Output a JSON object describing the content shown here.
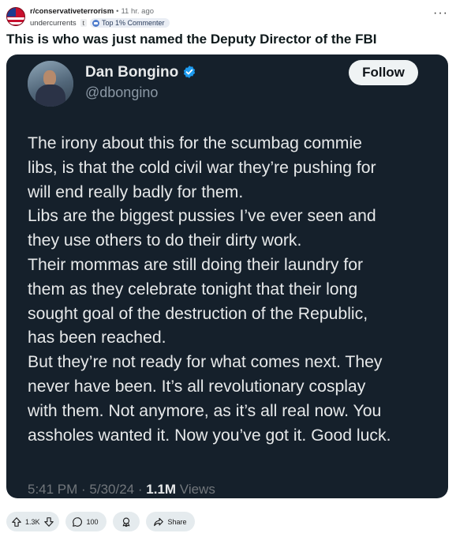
{
  "post": {
    "subreddit": "r/conservativeterrorism",
    "separator": "•",
    "time_ago": "11 hr. ago",
    "author": "undercurrents",
    "author_flair": "t",
    "commenter_badge": "Top 1% Commenter",
    "title": "This is who was just named the Deputy Director of the FBI",
    "more_icon": "more-horizontal-icon"
  },
  "tweet": {
    "display_name": "Dan Bongino",
    "handle": "@dbongino",
    "follow_label": "Follow",
    "verified_color": "#1d9bf0",
    "lines": [
      "The irony about this for the scumbag commie",
      "libs, is that the cold civil war they’re pushing for",
      "will end really badly for them.",
      "Libs are the biggest pussies I’ve ever seen and",
      "they use others to do their dirty work.",
      "Their mommas are still doing their laundry for",
      "them as they celebrate tonight that their long",
      "sought goal of the destruction of the Republic,",
      "has been reached.",
      "But they’re not ready for what comes next. They",
      "never have been. It’s all revolutionary cosplay",
      "with them. Not anymore, as it’s all real now. You",
      "assholes wanted it. Now you’ve got it. Good luck."
    ],
    "time": "5:41 PM",
    "meta_sep": " · ",
    "date": "5/30/24",
    "views_count": "1.1M",
    "views_label": "Views"
  },
  "actions": {
    "upvotes": "1.3K",
    "comments": "100",
    "share_label": "Share"
  },
  "colors": {
    "tweet_bg": "#15202b",
    "text": "#e7e9ea",
    "muted": "#71767b",
    "action_pill": "#e5ebee"
  }
}
